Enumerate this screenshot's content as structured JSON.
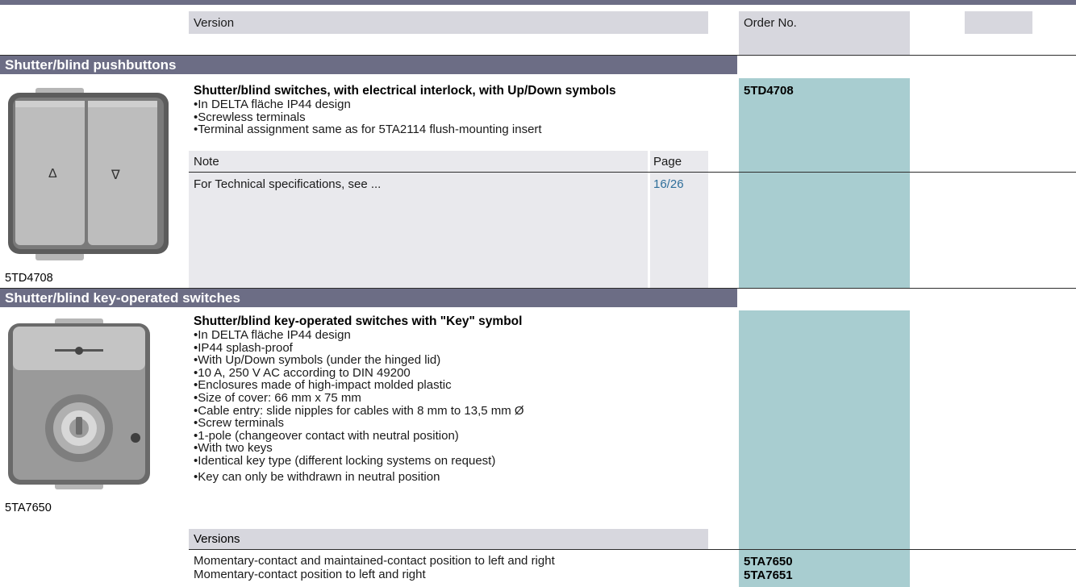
{
  "header": {
    "version_label": "Version",
    "order_label": "Order No."
  },
  "section1": {
    "title": "Shutter/blind pushbuttons",
    "product_title": "Shutter/blind switches, with electrical interlock, with Up/Down symbols",
    "bullets": [
      "In DELTA fläche IP44 design",
      "Screwless terminals",
      "Terminal assignment same as for 5TA2114 flush-mounting insert"
    ],
    "order_no": "5TD4708",
    "note_label": "Note",
    "page_label": "Page",
    "note_text": "For Technical specifications, see ...",
    "note_page": "16/26",
    "image_caption": "5TD4708",
    "image_symbols": {
      "up": "Δ",
      "down": "∇"
    },
    "image": "shutter-pushbutton-photo"
  },
  "section2": {
    "title": "Shutter/blind key-operated switches",
    "product_title": "Shutter/blind key-operated switches with \"Key\" symbol",
    "bullets": [
      "In DELTA fläche IP44 design",
      "IP44 splash-proof",
      "With Up/Down symbols (under the hinged lid)",
      "10 A, 250 V AC according to DIN 49200",
      "Enclosures made of high-impact molded plastic",
      "Size of cover: 66 mm x 75 mm",
      "Cable entry: slide nipples for cables with 8 mm to 13,5 mm Ø",
      "Screw terminals",
      "1-pole (changeover contact with neutral position)",
      "With two keys",
      "Identical key type (different locking systems on request)",
      "Key can only be withdrawn in neutral position"
    ],
    "versions_label": "Versions",
    "versions": [
      {
        "text": "Momentary-contact and maintained-contact position to left and right",
        "order_no": "5TA7650"
      },
      {
        "text": "Momentary-contact position to left and right",
        "order_no": "5TA7651"
      }
    ],
    "image_caption": "5TA7650",
    "image": "key-switch-photo"
  },
  "colors": {
    "section_header": "#6c6d85",
    "order_column": "#a8cdd0",
    "header_cell": "#d7d7de",
    "link": "#2e6e9a"
  }
}
